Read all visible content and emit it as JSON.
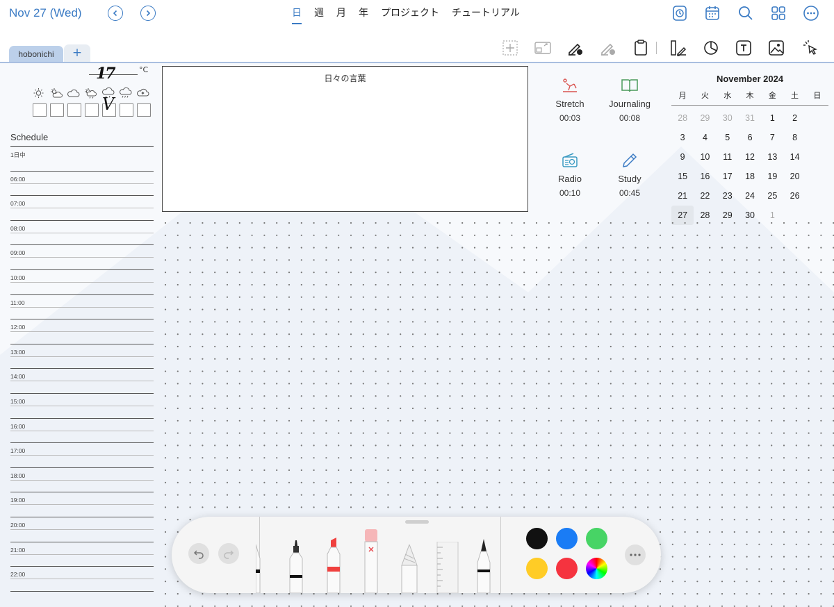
{
  "header": {
    "date_title": "Nov 27 (Wed)",
    "views": [
      "日",
      "週",
      "月",
      "年",
      "プロジェクト",
      "チュートリアル"
    ],
    "active_view": "日"
  },
  "tabs": {
    "current": "hobonichi",
    "add_label": "+"
  },
  "weather": {
    "temperature": "17",
    "unit": "°C",
    "check_mark": "V",
    "icons": [
      "sunny-icon",
      "partly-cloudy-icon",
      "cloudy-icon",
      "sun-rain-icon",
      "rain-icon",
      "heavy-rain-icon",
      "snow-icon"
    ]
  },
  "schedule": {
    "title": "Schedule",
    "rows": [
      "1日中",
      "06:00",
      "07:00",
      "08:00",
      "09:00",
      "10:00",
      "11:00",
      "12:00",
      "13:00",
      "14:00",
      "15:00",
      "16:00",
      "17:00",
      "18:00",
      "19:00",
      "20:00",
      "21:00",
      "22:00"
    ]
  },
  "quote": {
    "title": "日々の言葉"
  },
  "habits": [
    {
      "name": "Stretch",
      "time": "00:03",
      "icon": "stretch-icon",
      "color": "#d9534f"
    },
    {
      "name": "Journaling",
      "time": "00:08",
      "icon": "book-icon",
      "color": "#4a9a5b"
    },
    {
      "name": "Radio",
      "time": "00:10",
      "icon": "radio-icon",
      "color": "#3a9ac2"
    },
    {
      "name": "Study",
      "time": "00:45",
      "icon": "pencil-icon",
      "color": "#3b7bc4"
    }
  ],
  "calendar": {
    "title": "November 2024",
    "weekdays": [
      "月",
      "火",
      "水",
      "木",
      "金",
      "土",
      "日"
    ],
    "days": [
      {
        "d": "28",
        "muted": true
      },
      {
        "d": "29",
        "muted": true
      },
      {
        "d": "30",
        "muted": true
      },
      {
        "d": "31",
        "muted": true
      },
      {
        "d": "1"
      },
      {
        "d": "2"
      },
      {
        "d": "3"
      },
      {
        "d": "4"
      },
      {
        "d": "5"
      },
      {
        "d": "6"
      },
      {
        "d": "7"
      },
      {
        "d": "8"
      },
      {
        "d": "9"
      },
      {
        "d": "10"
      },
      {
        "d": "11"
      },
      {
        "d": "12"
      },
      {
        "d": "13"
      },
      {
        "d": "14"
      },
      {
        "d": "15"
      },
      {
        "d": "16"
      },
      {
        "d": "17"
      },
      {
        "d": "18"
      },
      {
        "d": "19"
      },
      {
        "d": "20"
      },
      {
        "d": "21"
      },
      {
        "d": "22"
      },
      {
        "d": "23"
      },
      {
        "d": "24"
      },
      {
        "d": "25"
      },
      {
        "d": "26"
      },
      {
        "d": "27",
        "today": true
      },
      {
        "d": "28"
      },
      {
        "d": "29"
      },
      {
        "d": "30"
      },
      {
        "d": "1",
        "muted": true
      }
    ]
  },
  "toolbar": {
    "colors": [
      "#111111",
      "#1a7cf5",
      "#47d465",
      "#ffcc26",
      "#f5333f",
      "rainbow"
    ]
  },
  "accent": "#3b7bc4"
}
